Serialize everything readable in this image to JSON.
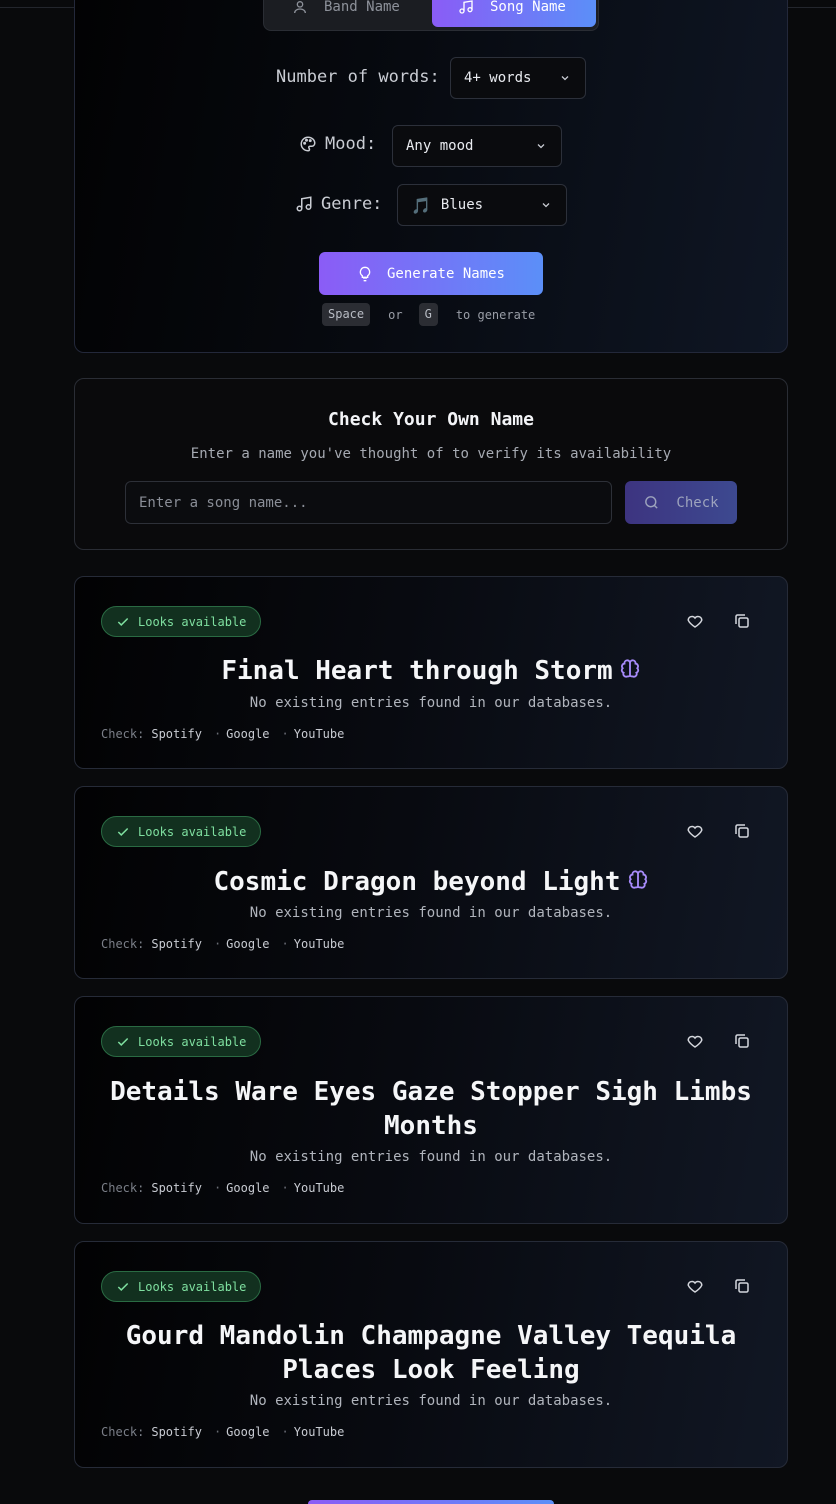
{
  "generator": {
    "toggle": {
      "band_label": "Band Name",
      "song_label": "Song Name"
    },
    "words": {
      "label": "Number of words:",
      "value": "4+ words"
    },
    "mood": {
      "label": "Mood:",
      "value": "Any mood"
    },
    "genre": {
      "label": "Genre:",
      "emoji": "🎵",
      "value": "Blues"
    },
    "generate_label": "Generate Names",
    "hint": {
      "key1": "Space",
      "or": "or",
      "key2": "G",
      "suffix": "to generate"
    }
  },
  "check": {
    "title": "Check Your Own Name",
    "subtitle": "Enter a name you've thought of to verify its availability",
    "placeholder": "Enter a song name...",
    "button_label": "Check"
  },
  "results": [
    {
      "badge": "Looks available",
      "name": "Final Heart through Storm",
      "desc": "No existing entries found in our databases.",
      "check_label": "Check:",
      "links": [
        "Spotify",
        "Google",
        "YouTube"
      ]
    },
    {
      "badge": "Looks available",
      "name": "Cosmic Dragon beyond Light",
      "desc": "No existing entries found in our databases.",
      "check_label": "Check:",
      "links": [
        "Spotify",
        "Google",
        "YouTube"
      ]
    },
    {
      "badge": "Looks available",
      "name": "Details Ware Eyes Gaze Stopper Sigh Limbs Months",
      "desc": "No existing entries found in our databases.",
      "check_label": "Check:",
      "links": [
        "Spotify",
        "Google",
        "YouTube"
      ]
    },
    {
      "badge": "Looks available",
      "name": "Gourd Mandolin Champagne Valley Tequila Places Look Feeling",
      "desc": "No existing entries found in our databases.",
      "check_label": "Check:",
      "links": [
        "Spotify",
        "Google",
        "YouTube"
      ]
    }
  ],
  "colors": {
    "accent_start": "#8b5cf6",
    "accent_end": "#5b8ff8",
    "available_green": "#7fe0a0",
    "brain_purple": "#a78bfa"
  }
}
